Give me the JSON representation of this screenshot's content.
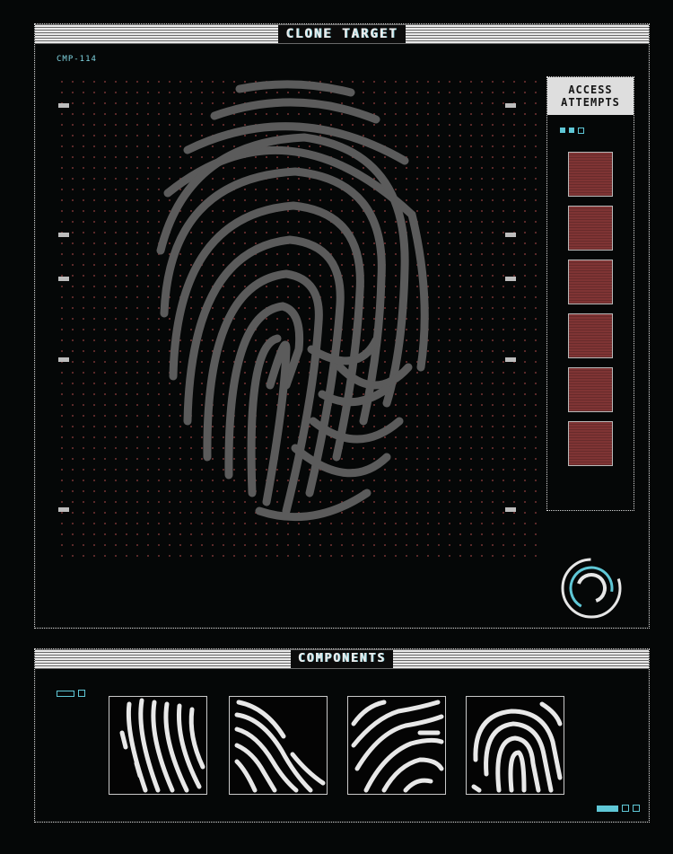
{
  "target_panel": {
    "title": "CLONE TARGET",
    "tag": "CMP-114"
  },
  "attempts": {
    "title_line1": "ACCESS",
    "title_line2": "ATTEMPTS",
    "count": 6
  },
  "components_panel": {
    "title": "COMPONENTS",
    "piece_count": 4
  },
  "colors": {
    "accent": "#5fc7d6",
    "attempt_block": "#7f3434",
    "panel_border": "#d8d8d8"
  },
  "icons": {
    "scanner": "fingerprint-icon",
    "loader": "spinner-ring-icon"
  }
}
